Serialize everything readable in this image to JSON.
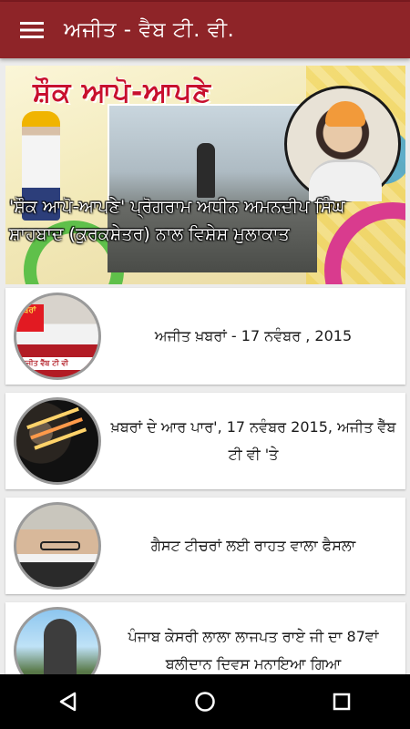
{
  "app": {
    "title": "ਅਜੀਤ - ਵੈਬ ਟੀ. ਵੀ."
  },
  "featured": {
    "banner": "ਸ਼ੌਕ ਆਪੋ-ਆਪਣੇ",
    "caption": "'ਸ਼ੌਕ ਆਪੋ-ਆਪਣੇ' ਪ੍ਰੋਗਰਾਮ ਅਧੀਨ ਅਮਨਦੀਪ ਸਿੰਘ ਸ਼ਾਹਬਾਦ (ਕੁਰਕਸ਼ੇਤਰ) ਨਾਲ ਵਿਸ਼ੇਸ਼ ਮੁਲਾਕਾਤ"
  },
  "items": [
    {
      "title": "ਅਜੀਤ ਖ਼ਬਰਾਂ - 17 ਨਵੰਬਰ , 2015",
      "thumb_badge": "ਖ਼ਬਰਾਂ",
      "thumb_strip": "ਅਜੀਤ ਵੈੱਬ ਟੀ ਵੀ"
    },
    {
      "title": "ਖ਼ਬਰਾਂ ਦੇ ਆਰ ਪਾਰ', 17 ਨਵੰਬਰ 2015, ਅਜੀਤ ਵੈੱਬ ਟੀ ਵੀ 'ਤੇ"
    },
    {
      "title": "ਗੈਸਟ ਟੀਚਰਾਂ ਲਈ ਰਾਹਤ ਵਾਲਾ ਫੈਸਲਾ"
    },
    {
      "title": "ਪੰਜਾਬ ਕੇਸਰੀ ਲਾਲਾ ਲਾਜਪਤ ਰਾਏ ਜੀ ਦਾ 87ਵਾਂ ਬਲੀਦਾਨ ਦਿਵਸ ਮਨਾਇਆ ਗਿਆ"
    }
  ],
  "icons": {
    "menu": "hamburger-icon",
    "back": "back-triangle-icon",
    "home": "home-circle-icon",
    "recents": "recents-square-icon"
  },
  "colors": {
    "appbar": "#8e2428",
    "navbar": "#000000",
    "background": "#ececec"
  }
}
